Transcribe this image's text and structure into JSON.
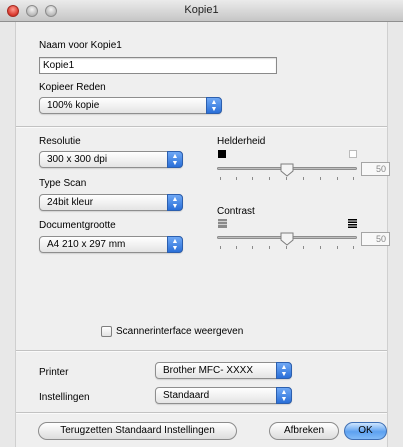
{
  "window": {
    "title": "Kopie1"
  },
  "name": {
    "label": "Naam voor Kopie1",
    "value": "Kopie1"
  },
  "reason": {
    "label": "Kopieer Reden",
    "value": "100% kopie"
  },
  "resolution": {
    "label": "Resolutie",
    "value": "300 x 300 dpi"
  },
  "scan_type": {
    "label": "Type Scan",
    "value": "24bit kleur"
  },
  "document_size": {
    "label": "Documentgrootte",
    "value": "A4  210 x 297 mm"
  },
  "brightness": {
    "label": "Helderheid",
    "value": "50"
  },
  "contrast": {
    "label": "Contrast",
    "value": "50"
  },
  "scanner_interface": {
    "label": "Scannerinterface weergeven",
    "checked": false
  },
  "printer": {
    "label": "Printer",
    "value": "Brother MFC- XXXX"
  },
  "settings": {
    "label": "Instellingen",
    "value": "Standaard"
  },
  "buttons": {
    "reset": "Terugzetten Standaard Instellingen",
    "cancel": "Afbreken",
    "ok": "OK"
  },
  "colors": {
    "accent": "#3b82e6",
    "close": "#d8352a"
  }
}
